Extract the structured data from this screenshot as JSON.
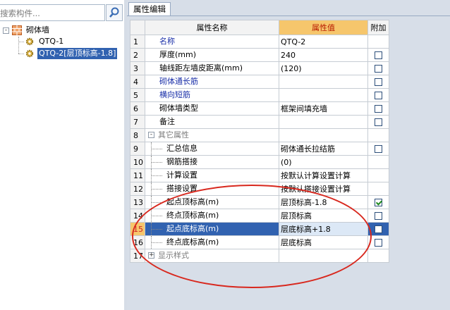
{
  "search": {
    "placeholder": "搜索构件..."
  },
  "tree": {
    "root_label": "砌体墙",
    "root_expander": "-",
    "items": [
      {
        "label": "QTQ-1",
        "selected": false
      },
      {
        "label": "QTQ-2[层顶标高-1.8]",
        "selected": true
      }
    ]
  },
  "tab": {
    "label": "属性编辑"
  },
  "grid": {
    "headers": {
      "name": "属性名称",
      "value": "属性值",
      "extra": "附加"
    },
    "rows": [
      {
        "num": "1",
        "name": "名称",
        "value": "QTQ-2",
        "checkbox": "none",
        "style": "blue",
        "indent": 0,
        "tree": "none"
      },
      {
        "num": "2",
        "name": "厚度(mm)",
        "value": "240",
        "checkbox": "off",
        "style": "normal",
        "indent": 0,
        "tree": "none"
      },
      {
        "num": "3",
        "name": "轴线距左墙皮距离(mm)",
        "value": "(120)",
        "checkbox": "off",
        "style": "normal",
        "indent": 0,
        "tree": "none"
      },
      {
        "num": "4",
        "name": "砌体通长筋",
        "value": "",
        "checkbox": "off",
        "style": "blue",
        "indent": 0,
        "tree": "none"
      },
      {
        "num": "5",
        "name": "横向短筋",
        "value": "",
        "checkbox": "off",
        "style": "blue",
        "indent": 0,
        "tree": "none"
      },
      {
        "num": "6",
        "name": "砌体墙类型",
        "value": "框架间填充墙",
        "checkbox": "off",
        "style": "normal",
        "indent": 0,
        "tree": "none"
      },
      {
        "num": "7",
        "name": "备注",
        "value": "",
        "checkbox": "off",
        "style": "normal",
        "indent": 0,
        "tree": "none"
      },
      {
        "num": "8",
        "name": "其它属性",
        "value": "",
        "checkbox": "none",
        "style": "gray",
        "indent": 0,
        "tree": "group",
        "expander": "-"
      },
      {
        "num": "9",
        "name": "汇总信息",
        "value": "砌体通长拉结筋",
        "checkbox": "off",
        "style": "normal",
        "indent": 1,
        "tree": "child"
      },
      {
        "num": "10",
        "name": "钢筋搭接",
        "value": "(0)",
        "checkbox": "none",
        "style": "normal",
        "indent": 1,
        "tree": "child"
      },
      {
        "num": "11",
        "name": "计算设置",
        "value": "按默认计算设置计算",
        "checkbox": "none",
        "style": "normal",
        "indent": 1,
        "tree": "child"
      },
      {
        "num": "12",
        "name": "搭接设置",
        "value": "按默认搭接设置计算",
        "checkbox": "none",
        "style": "normal",
        "indent": 1,
        "tree": "child"
      },
      {
        "num": "13",
        "name": "起点顶标高(m)",
        "value": "层顶标高-1.8",
        "checkbox": "on",
        "style": "normal",
        "indent": 1,
        "tree": "child"
      },
      {
        "num": "14",
        "name": "终点顶标高(m)",
        "value": "层顶标高",
        "checkbox": "off",
        "style": "normal",
        "indent": 1,
        "tree": "child"
      },
      {
        "num": "15",
        "name": "起点底标高(m)",
        "value": "层底标高+1.8",
        "checkbox": "off",
        "style": "normal",
        "indent": 1,
        "tree": "child",
        "active": true
      },
      {
        "num": "16",
        "name": "终点底标高(m)",
        "value": "层底标高",
        "checkbox": "off",
        "style": "normal",
        "indent": 1,
        "tree": "child"
      },
      {
        "num": "17",
        "name": "显示样式",
        "value": "",
        "checkbox": "none",
        "style": "gray",
        "indent": 0,
        "tree": "group",
        "expander": "+"
      }
    ]
  },
  "colors": {
    "selection": "#3162b0",
    "header_highlight": "#f6c66c",
    "annotation": "#d8281e",
    "link_blue": "#1a2fa8"
  },
  "icons": {
    "search": "magnifier-icon",
    "wall": "brick-wall-icon",
    "component": "gear-icon"
  }
}
